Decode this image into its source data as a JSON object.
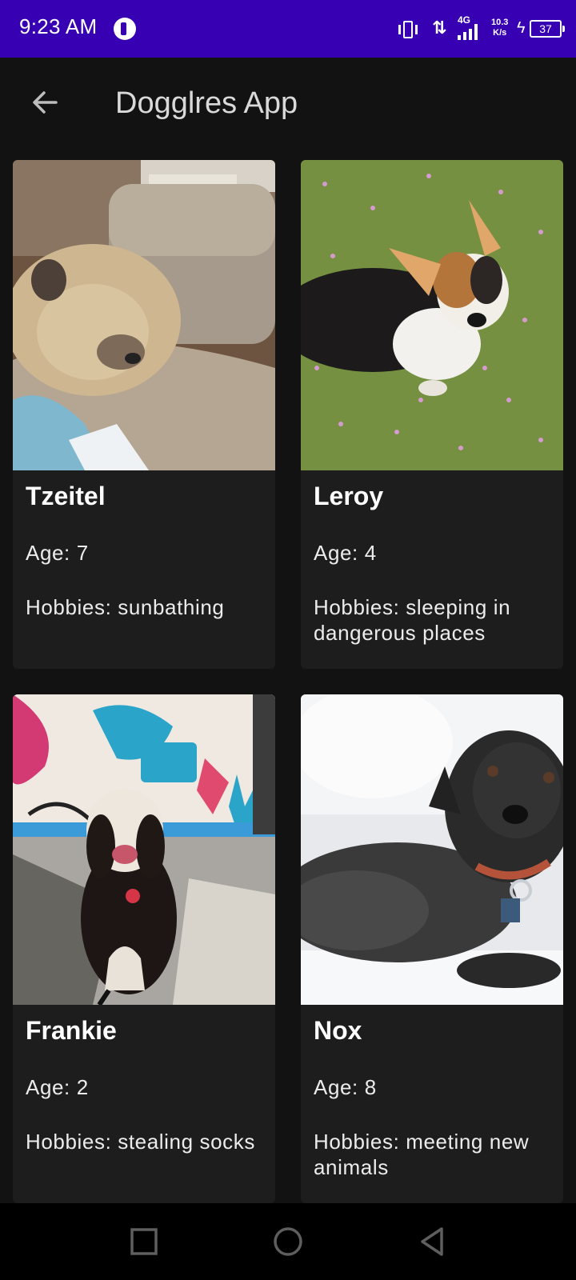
{
  "status_bar": {
    "time": "9:23 AM",
    "network": "4G",
    "speed_value": "10.3",
    "speed_unit": "K/s",
    "battery": "37",
    "icons": [
      "vibrate-icon",
      "data-arrows-icon",
      "signal-icon",
      "charging-icon",
      "battery-icon"
    ]
  },
  "top_bar": {
    "title": "Dogglres App",
    "back_icon": "arrow-back-icon"
  },
  "dogs": [
    {
      "name": "Tzeitel",
      "age": "Age: 7",
      "hobbies": "Hobbies: sunbathing"
    },
    {
      "name": "Leroy",
      "age": "Age: 4",
      "hobbies": "Hobbies: sleeping in dangerous places"
    },
    {
      "name": "Frankie",
      "age": "Age: 2",
      "hobbies": "Hobbies: stealing socks"
    },
    {
      "name": "Nox",
      "age": "Age: 8",
      "hobbies": "Hobbies: meeting new animals"
    }
  ],
  "nav_bar": {
    "buttons": [
      "recents-square-icon",
      "home-circle-icon",
      "back-triangle-icon"
    ]
  },
  "colors": {
    "status_bar": "#3700b3",
    "background": "#121212",
    "card": "#1d1d1d",
    "nav_bar": "#000000"
  }
}
